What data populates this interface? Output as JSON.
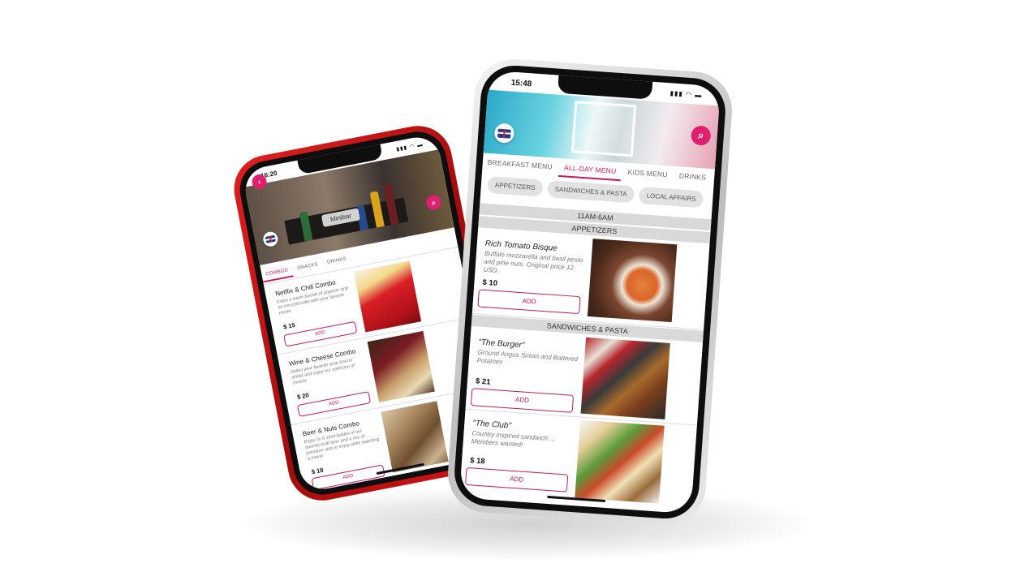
{
  "phone_left": {
    "status": {
      "time": "16:20",
      "icons": "▮▮▮ ◠ ▬"
    },
    "hero_label": "Minibar",
    "back_icon": "‹",
    "search_icon": "⌕",
    "tabs": [
      "COMBOS",
      "SNACKS",
      "DRINKS"
    ],
    "active_tab": "COMBOS",
    "items": [
      {
        "name": "Netflix & Chill Combo",
        "desc": "Enjoy a warm bucket of popcorn and an ice-cold coke with your favorite movie.",
        "price": "$ 15",
        "add": "ADD"
      },
      {
        "name": "Wine & Cheese Combo",
        "desc": "Select your favorite wine (red or white) and enjoy our selection of cheese.",
        "price": "$ 20",
        "add": "ADD"
      },
      {
        "name": "Beer & Nuts Combo",
        "desc": "Enjoy 2x 0.33ml bottles of our favorite craft beer and a mix of premium nuts to enjoy while watching a movie.",
        "price": "$ 18",
        "add": "ADD"
      }
    ]
  },
  "phone_right": {
    "status": {
      "time": "15:48",
      "icons": "▮▮▮ ◠ ▬"
    },
    "search_icon": "⌕",
    "tabs": [
      "BREAKFAST MENU",
      "ALL-DAY MENU",
      "KIDS MENU",
      "DRINKS"
    ],
    "active_tab": "ALL-DAY MENU",
    "chips": [
      "APPETIZERS",
      "SANDWICHES & PASTA",
      "LOCAL AFFAIRS"
    ],
    "hours": "11AM-6AM",
    "sections": {
      "appetizers": "APPETIZERS",
      "sandwiches": "SANDWICHES & PASTA"
    },
    "items": [
      {
        "name": "Rich Tomato Bisque",
        "desc": "Buffalo mozzarella and basil pesto and pine nuts. Original price 12 USD.",
        "price": "$ 10",
        "add": "ADD"
      },
      {
        "name": "\"The Burger\"",
        "desc": "Ground Angus Sirloin and Battered Potatoes",
        "price": "$ 21",
        "add": "ADD"
      },
      {
        "name": "\"The Club\"",
        "desc": "Country inspired sandwich ... Members wanted!",
        "price": "$ 18",
        "add": "ADD"
      }
    ]
  },
  "colors": {
    "accent": "#c2185b",
    "accent_button": "#e0206e",
    "left_phone_body": "#c8141a",
    "right_phone_body": "#e6e6e6"
  }
}
